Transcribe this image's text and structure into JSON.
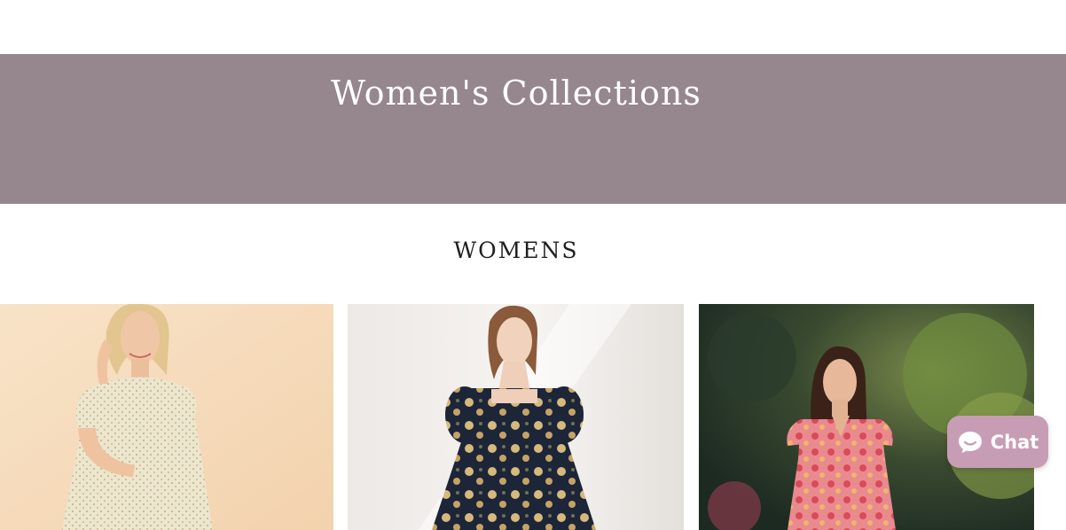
{
  "banner": {
    "title": "Women's Collections",
    "background_color": "#96868e"
  },
  "section": {
    "title": "WOMENS"
  },
  "products": [
    {
      "image": "woman-in-cream-floral-smocked-dress"
    },
    {
      "image": "woman-in-navy-floral-puff-sleeve-dress"
    },
    {
      "image": "woman-in-pink-floral-dress-outdoors"
    }
  ],
  "chat": {
    "label": "Chat",
    "icon": "chat-bubble-icon",
    "color": "#c79db5"
  }
}
